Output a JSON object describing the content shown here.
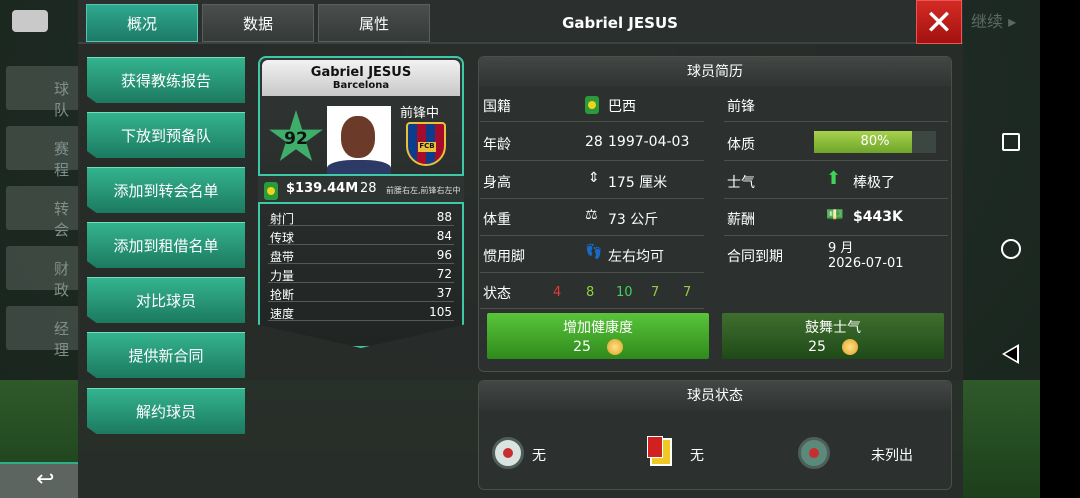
{
  "background": {
    "continue_label": "继续",
    "side_items": [
      "球队",
      "赛程",
      "转会",
      "财政",
      "经理"
    ]
  },
  "tabs": [
    "概况",
    "数据",
    "属性"
  ],
  "header": {
    "title": "Gabriel JESUS"
  },
  "actions": [
    "获得教练报告",
    "下放到预备队",
    "添加到转会名单",
    "添加到租借名单",
    "对比球员",
    "提供新合同",
    "解约球员"
  ],
  "card": {
    "name": "Gabriel JESUS",
    "club": "Barcelona",
    "rating": "92",
    "position": "前锋中",
    "value": "$139.44M",
    "age": "28",
    "positions_short": "前腰右左,前锋右左中",
    "crest_text": "FCB",
    "stats": [
      {
        "label": "射门",
        "value": "88"
      },
      {
        "label": "传球",
        "value": "84"
      },
      {
        "label": "盘带",
        "value": "96"
      },
      {
        "label": "力量",
        "value": "72"
      },
      {
        "label": "抢断",
        "value": "37"
      },
      {
        "label": "速度",
        "value": "105"
      }
    ]
  },
  "profile": {
    "title": "球员简历",
    "nationality_label": "国籍",
    "nationality": "巴西",
    "age_label": "年龄",
    "age": "28",
    "dob": "1997-04-03",
    "height_label": "身高",
    "height": "175 厘米",
    "weight_label": "体重",
    "weight": "73 公斤",
    "foot_label": "惯用脚",
    "foot": "左右均可",
    "form_label": "状态",
    "form": [
      {
        "value": "4",
        "color": "#e03a3a"
      },
      {
        "value": "8",
        "color": "#8fd13d"
      },
      {
        "value": "10",
        "color": "#3fd45a"
      },
      {
        "value": "7",
        "color": "#8fd13d"
      },
      {
        "value": "7",
        "color": "#8fd13d"
      }
    ],
    "position": "前锋",
    "fitness_label": "体质",
    "fitness": "80%",
    "fitness_fraction": 0.8,
    "morale_label": "士气",
    "morale": "棒极了",
    "salary_label": "薪酬",
    "salary": "$443K",
    "contract_label": "合同到期",
    "contract_month": "9 月",
    "contract_date": "2026-07-01",
    "btn_fitness": "增加健康度",
    "btn_fitness_cost": "25",
    "btn_morale": "鼓舞士气",
    "btn_morale_cost": "25"
  },
  "status": {
    "title": "球员状态",
    "injury": "无",
    "cards": "无",
    "listed": "未列出"
  },
  "colors": {
    "accent": "#2fa88f",
    "close": "#c41d18",
    "green_button": "#3fa42a"
  }
}
